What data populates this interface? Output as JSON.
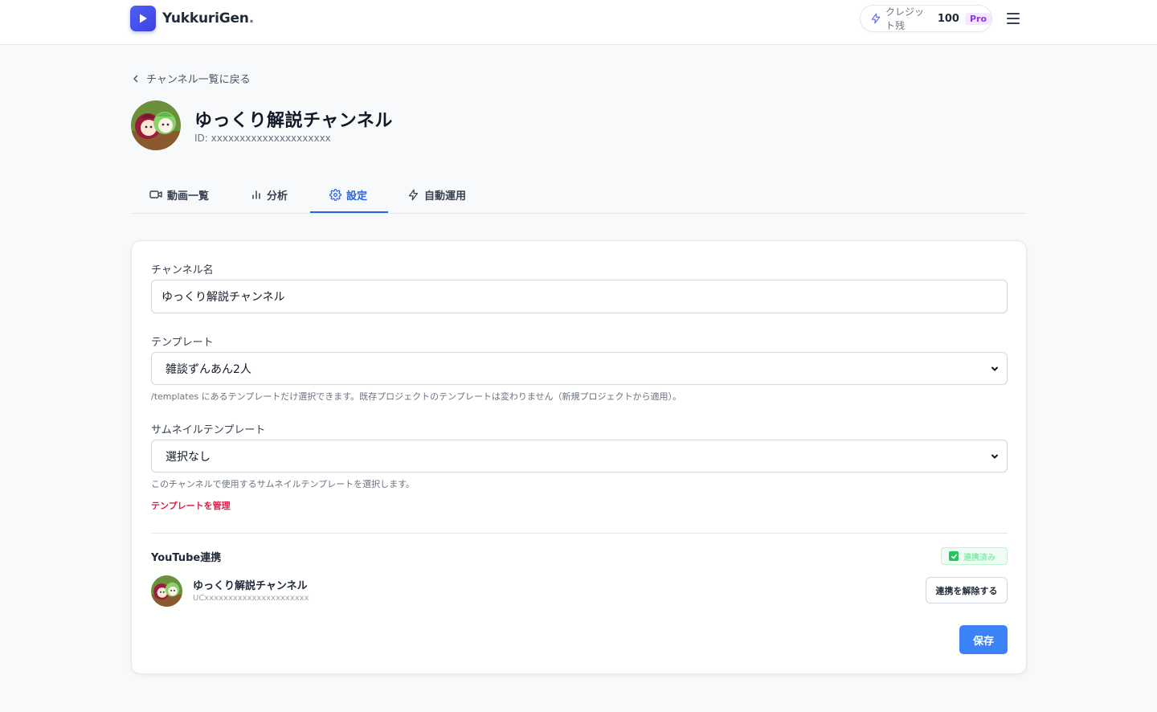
{
  "header": {
    "logo_text": "YukkuriGen",
    "logo_suffix": ".",
    "credit_label": "クレジット残",
    "credit_value": "100",
    "plan_badge": "Pro"
  },
  "back_link": {
    "label": "チャンネル一覧に戻る"
  },
  "channel": {
    "title": "ゆっくり解説チャンネル",
    "id_text": "ID: xxxxxxxxxxxxxxxxxxxxx"
  },
  "tabs": [
    {
      "label": "動画一覧",
      "icon": "video-icon"
    },
    {
      "label": "分析",
      "icon": "bar-chart-icon"
    },
    {
      "label": "設定",
      "icon": "gear-icon",
      "active": true
    },
    {
      "label": "自動運用",
      "icon": "bolt-icon"
    }
  ],
  "form": {
    "channel_name_label": "チャンネル名",
    "channel_name_value": "ゆっくり解説チャンネル",
    "template_label": "テンプレート",
    "template_value": "雑談ずんあん2人",
    "template_help": "/templates にあるテンプレートだけ選択できます。既存プロジェクトのテンプレートは変わりません（新規プロジェクトから適用）。",
    "thumbnail_label": "サムネイルテンプレート",
    "thumbnail_value": "選択なし",
    "thumbnail_help": "このチャンネルで使用するサムネイルテンプレートを選択します。",
    "manage_link": "テンプレートを管理"
  },
  "youtube": {
    "section_title": "YouTube連携",
    "status_badge": "連携済み",
    "channel_name": "ゆっくり解説チャンネル",
    "channel_id": "UCxxxxxxxxxxxxxxxxxxxxxx",
    "unlink_button": "連携を解除する"
  },
  "save_button": "保存",
  "colors": {
    "accent": "#2563eb",
    "save": "#3b82f6",
    "brand": "#3b44e0",
    "link": "#e11d48",
    "linked": "#22c55e"
  }
}
